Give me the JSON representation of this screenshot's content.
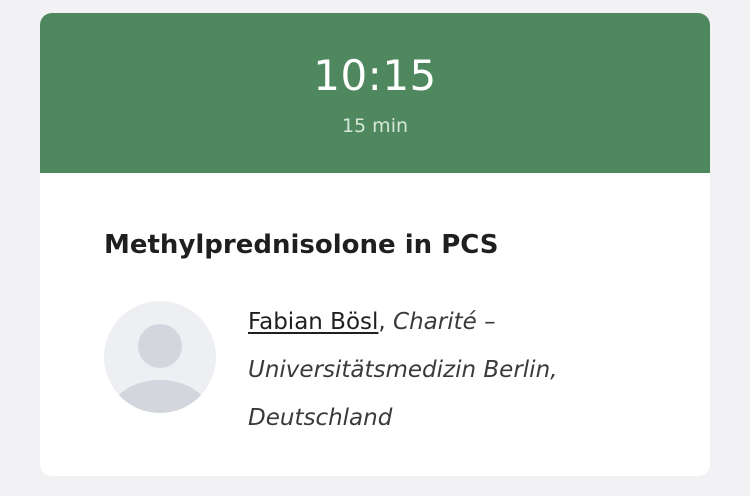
{
  "session": {
    "time": "10:15",
    "duration": "15 min"
  },
  "talk": {
    "title": "Methylprednisolone in PCS"
  },
  "speaker": {
    "name": "Fabian Bösl",
    "separator": ", ",
    "affiliation": "Charité – Universitätsmedizin Berlin, Deutschland",
    "avatar_icon": "person-placeholder-icon"
  },
  "colors": {
    "header_bg": "#4f875e",
    "header_text": "#ffffff",
    "card_bg": "#ffffff",
    "page_bg": "#f2f2f4"
  }
}
